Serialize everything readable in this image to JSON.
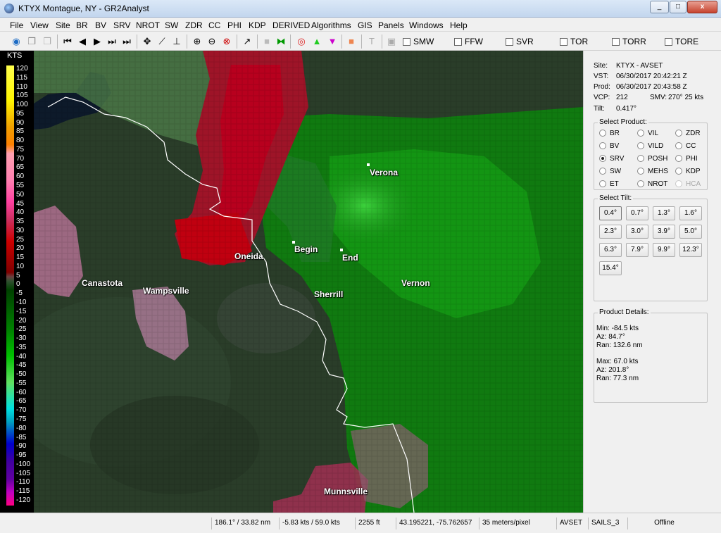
{
  "window": {
    "title": "KTYX Montague, NY - GR2Analyst",
    "min": "_",
    "max": "□",
    "close": "x"
  },
  "menu": [
    "File",
    "View",
    "Site",
    "BR",
    "BV",
    "SRV",
    "NROT",
    "SW",
    "ZDR",
    "CC",
    "PHI",
    "KDP",
    "DERIVED",
    "Algorithms",
    "GIS",
    "Panels",
    "Windows",
    "Help"
  ],
  "warnings": [
    "SMW",
    "FFW",
    "SVR",
    "TOR",
    "TORR",
    "TORE"
  ],
  "legend": {
    "units": "KTS",
    "ticks": [
      "120",
      "115",
      "110",
      "105",
      "100",
      "95",
      "90",
      "85",
      "80",
      "75",
      "70",
      "65",
      "60",
      "55",
      "50",
      "45",
      "40",
      "35",
      "30",
      "25",
      "20",
      "15",
      "10",
      "5",
      "0",
      "-5",
      "-10",
      "-15",
      "-20",
      "-25",
      "-30",
      "-35",
      "-40",
      "-45",
      "-50",
      "-55",
      "-60",
      "-65",
      "-70",
      "-75",
      "-80",
      "-85",
      "-90",
      "-95",
      "-100",
      "-105",
      "-110",
      "-115",
      "-120"
    ]
  },
  "map": {
    "cities": [
      {
        "name": "Verona"
      },
      {
        "name": "Begin"
      },
      {
        "name": "End"
      },
      {
        "name": "Oneida"
      },
      {
        "name": "Canastota"
      },
      {
        "name": "Wampsville"
      },
      {
        "name": "Sherrill"
      },
      {
        "name": "Vernon"
      },
      {
        "name": "Munnsville"
      }
    ]
  },
  "info": {
    "site_label": "Site:",
    "site_value": "KTYX - AVSET",
    "vst_label": "VST:",
    "vst_value": "06/30/2017  20:42:21 Z",
    "prod_label": "Prod:",
    "prod_value": "06/30/2017  20:43:58 Z",
    "vcp_label": "VCP:",
    "vcp_value": "212",
    "smv_label": "SMV:",
    "smv_value": "270° 25 kts",
    "tilt_label": "Tilt:",
    "tilt_value": "0.417°"
  },
  "select_product": {
    "label": "Select Product:",
    "options": [
      "BR",
      "VIL",
      "ZDR",
      "BV",
      "VILD",
      "CC",
      "SRV",
      "POSH",
      "PHI",
      "SW",
      "MEHS",
      "KDP",
      "ET",
      "NROT",
      "HCA"
    ],
    "selected": "SRV",
    "disabled": [
      "HCA"
    ]
  },
  "select_tilt": {
    "label": "Select Tilt:",
    "tilts": [
      "0.4°",
      "0.7°",
      "1.3°",
      "1.6°",
      "2.3°",
      "3.0°",
      "3.9°",
      "5.0°",
      "6.3°",
      "7.9°",
      "9.9°",
      "12.3°",
      "15.4°"
    ],
    "selected": "0.4°"
  },
  "product_details": {
    "label": "Product Details:",
    "min": "Min:  -84.5 kts",
    "min_az": "Az:  84.7°",
    "min_ran": "Ran:  132.6 nm",
    "max": "Max:  67.0 kts",
    "max_az": "Az:  201.8°",
    "max_ran": "Ran:  77.3 nm"
  },
  "status": [
    "186.1° / 33.82 nm",
    "-5.83 kts / 59.0 kts",
    "2255 ft",
    "43.195221, -75.762657",
    "35 meters/pixel",
    "AVSET",
    "SAILS_3",
    "Offline"
  ],
  "colors": {
    "titlebar": "#c9dbf1",
    "panel_bg": "#f0f0f0",
    "velocity_in": "#00a000",
    "velocity_out": "#b00020"
  }
}
